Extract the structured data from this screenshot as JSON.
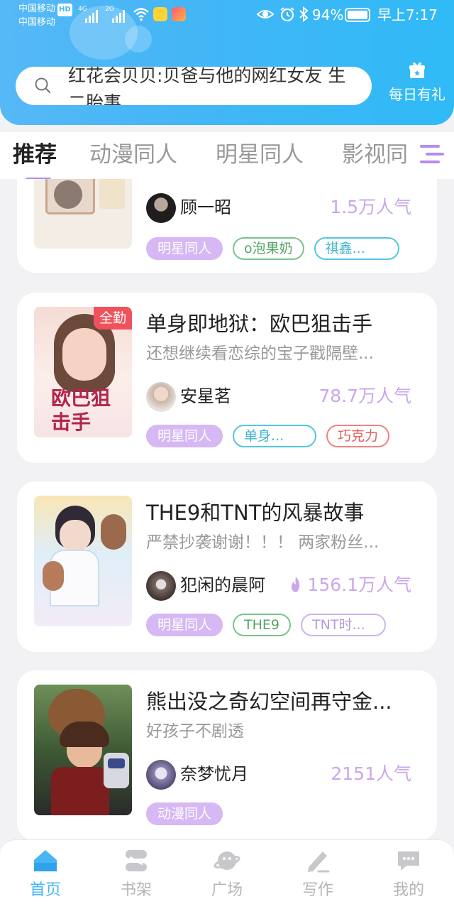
{
  "status_bar": {
    "carrier1": "中国移动",
    "carrier2": "中国移动",
    "hd": "HD",
    "signal1_label": "4G",
    "signal2_label": "2G",
    "battery": "94%",
    "time": "早上7:17"
  },
  "header": {
    "search_text": "红花会贝贝:贝爸与他的网红女友 生二胎事",
    "gift_label": "每日有礼"
  },
  "tabs": [
    "推荐",
    "动漫同人",
    "明星同人",
    "影视同"
  ],
  "cards": [
    {
      "title": "",
      "desc": "",
      "author": "顾一昭",
      "popularity": "1.5万人气",
      "badge": "",
      "tags": [
        {
          "text": "明星同人",
          "style": "purple-fill"
        },
        {
          "text": "o泡果奶",
          "style": "green"
        },
        {
          "text": "祺鑫...",
          "style": "cyan"
        }
      ]
    },
    {
      "title": "单身即地狱：欧巴狙击手",
      "desc": "还想继续看恋综的宝子戳隔壁...",
      "author": "安星茗",
      "popularity": "78.7万人气",
      "badge": "全勤",
      "cover_text": "欧巴狙击手",
      "tags": [
        {
          "text": "明星同人",
          "style": "purple-fill"
        },
        {
          "text": "单身...",
          "style": "cyan"
        },
        {
          "text": "巧克力",
          "style": "red"
        }
      ]
    },
    {
      "title": "THE9和TNT的风暴故事",
      "desc": "严禁抄袭谢谢！！！ 两家粉丝...",
      "author": "犯闲的晨阿",
      "popularity": "156.1万人气",
      "badge": "",
      "tags": [
        {
          "text": "明星同人",
          "style": "purple-fill"
        },
        {
          "text": "THE9",
          "style": "green"
        },
        {
          "text": "TNT时...",
          "style": "lilac"
        }
      ]
    },
    {
      "title": "熊出没之奇幻空间再守金...",
      "desc": "好孩子不剧透",
      "author": "奈梦忧月",
      "popularity": "2151人气",
      "badge": "",
      "tags": [
        {
          "text": "动漫同人",
          "style": "purple-fill"
        }
      ]
    }
  ],
  "bottom_nav": [
    {
      "label": "首页",
      "icon": "home-icon",
      "active": true
    },
    {
      "label": "书架",
      "icon": "bookshelf-icon",
      "active": false
    },
    {
      "label": "广场",
      "icon": "planet-icon",
      "active": false
    },
    {
      "label": "写作",
      "icon": "pen-icon",
      "active": false
    },
    {
      "label": "我的",
      "icon": "chat-icon",
      "active": false
    }
  ],
  "colors": {
    "header": "#44b6f6",
    "accent_purple": "#c9a7ee",
    "nav_active": "#46b5f4"
  }
}
